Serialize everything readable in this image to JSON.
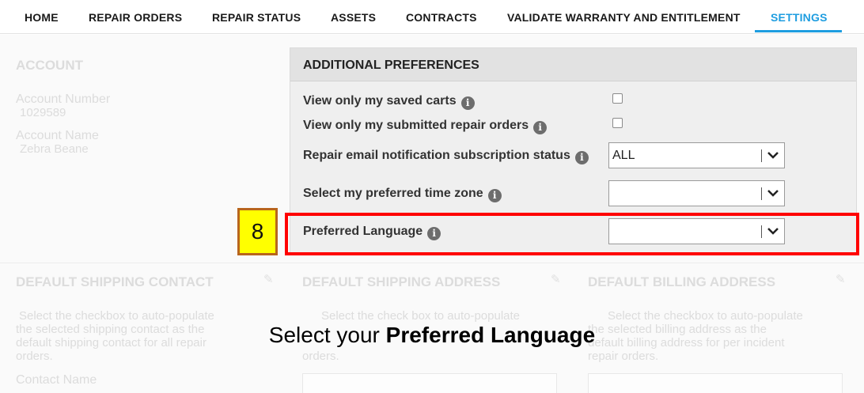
{
  "nav": {
    "items": [
      "HOME",
      "REPAIR ORDERS",
      "REPAIR STATUS",
      "ASSETS",
      "CONTRACTS",
      "VALIDATE WARRANTY AND ENTITLEMENT",
      "SETTINGS"
    ],
    "active": "SETTINGS",
    "accent_color": "#1e9de0"
  },
  "background": {
    "account_heading": "ACCOUNT",
    "account_number_label": "Account Number",
    "account_number_value": "1029589",
    "account_name_label": "Account Name",
    "account_name_value": "Zebra Beane",
    "shipping_contact_heading": "DEFAULT SHIPPING CONTACT",
    "shipping_contact_text": [
      "Select the checkbox to auto-populate",
      "the selected shipping contact as the",
      "default shipping contact for all repair",
      "orders."
    ],
    "contact_name_label": "Contact Name",
    "shipping_address_heading": "DEFAULT SHIPPING ADDRESS",
    "shipping_address_text": [
      "Select the check box to auto-populate",
      "the selected shipping address as the",
      "default shipping address for all repair",
      "orders."
    ],
    "billing_address_heading": "DEFAULT BILLING ADDRESS",
    "billing_address_text": [
      "Select the checkbox to auto-populate",
      "the selected billing address as the",
      "default billing address for per incident",
      "repair orders."
    ]
  },
  "preferences": {
    "title": "ADDITIONAL PREFERENCES",
    "saved_carts_label": "View only my saved carts",
    "submitted_orders_label": "View only my submitted repair orders",
    "email_notification_label": "Repair email notification subscription status",
    "email_notification_value": "ALL",
    "time_zone_label": "Select my preferred time zone",
    "time_zone_value": "",
    "language_label": "Preferred Language",
    "language_value": "",
    "info_icon_glyph": "i"
  },
  "tutorial": {
    "step_number": "8",
    "caption_prefix": "Select your ",
    "caption_bold": "Preferred Language",
    "highlight_color": "#ff0000",
    "badge_color": "#ffff00"
  }
}
